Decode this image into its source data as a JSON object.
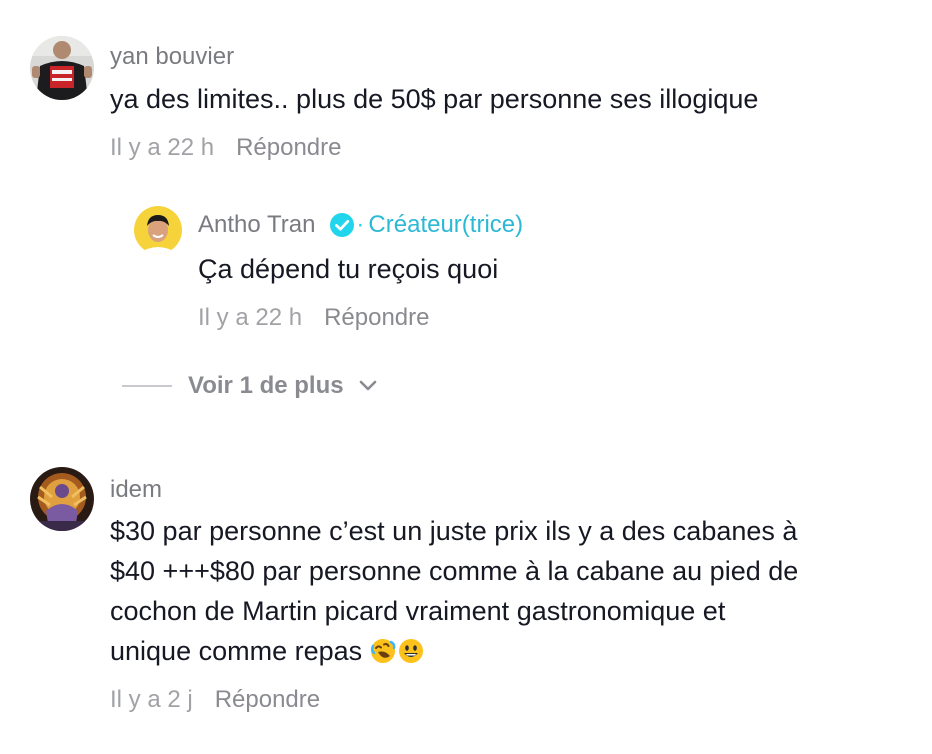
{
  "comments": [
    {
      "username": "yan bouvier",
      "text": "ya des limites.. plus de 50$ par personne ses illogique",
      "time": "Il y a 22 h",
      "reply_label": "Répondre",
      "replies": [
        {
          "username": "Antho Tran",
          "badge": "Créateur(trice)",
          "text": "Ça dépend tu reçois quoi",
          "time": "Il y a 22 h",
          "reply_label": "Répondre"
        }
      ],
      "view_more_label": "Voir 1 de plus"
    },
    {
      "username": "idem",
      "text_lines": [
        "$30 par personne c’est un juste prix ils y a des cabanes à",
        "$40 +++$80 par personne comme à la cabane au pied de",
        "cochon de Martin picard vraiment gastronomique et",
        "unique comme repas "
      ],
      "emojis": [
        "rolling-on-floor-laughing-emoji",
        "grinning-face-emoji"
      ],
      "time": "Il y a 2 j",
      "reply_label": "Répondre"
    }
  ],
  "colors": {
    "username": "#7a7b80",
    "text": "#161823",
    "meta": "#a1a2a6",
    "creator_badge": "#2bb9d4",
    "verified": "#20d5ec"
  }
}
